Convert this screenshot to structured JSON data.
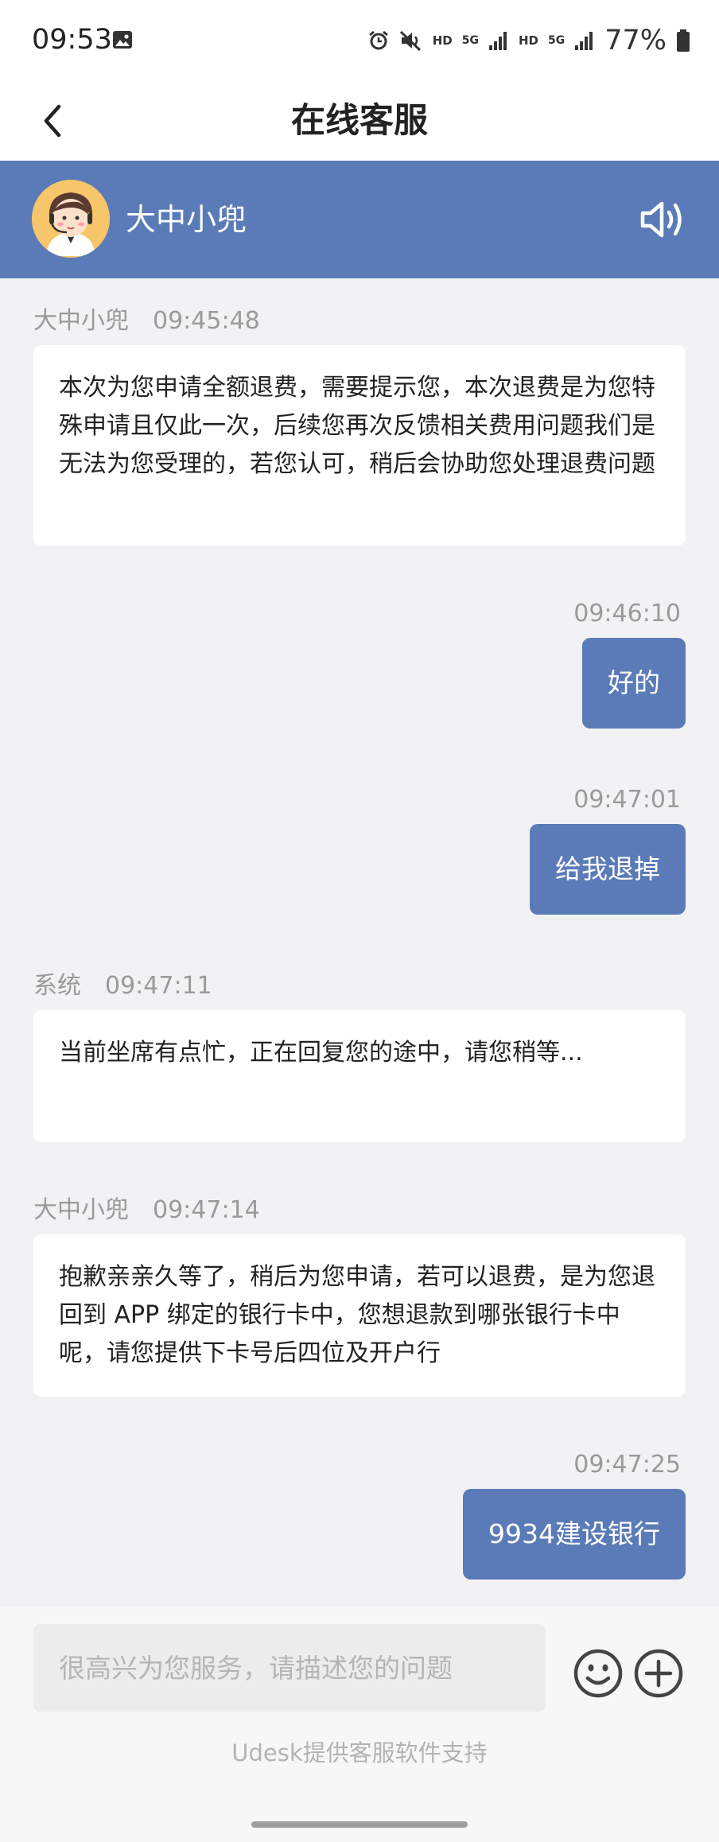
{
  "status_bar": {
    "time": "09:53",
    "hd1": "HD",
    "net1": "5G",
    "hd2": "HD",
    "net2": "5G",
    "battery": "77%"
  },
  "header": {
    "title": "在线客服"
  },
  "agent": {
    "name": "大中小兜"
  },
  "messages": [
    {
      "sender": "大中小兜",
      "time": "09:45:48",
      "text": "本次为您申请全额退费，需要提示您，本次退费是为您特殊申请且仅此一次，后续您再次反馈相关费用问题我们是无法为您受理的，若您认可，稍后会协助您处理退费问题"
    },
    {
      "time": "09:46:10",
      "text": "好的"
    },
    {
      "time": "09:47:01",
      "text": "给我退掉"
    },
    {
      "sender": "系统",
      "time": "09:47:11",
      "text": "当前坐席有点忙，正在回复您的途中，请您稍等..."
    },
    {
      "sender": "大中小兜",
      "time": "09:47:14",
      "text": "抱歉亲亲久等了，稍后为您申请，若可以退费，是为您退回到 APP 绑定的银行卡中，您想退款到哪张银行卡中呢，请您提供下卡号后四位及开户行"
    },
    {
      "time": "09:47:25",
      "text": "9934建设银行"
    }
  ],
  "input": {
    "placeholder": "很高兴为您服务，请描述您的问题"
  },
  "footer": {
    "note": "Udesk提供客服软件支持"
  },
  "colors": {
    "accent": "#5b7bb8",
    "background": "#f2f2f4",
    "bubble_in": "#ffffff"
  },
  "icons": [
    "gallery-icon",
    "alarm-icon",
    "mute-icon",
    "signal-icon",
    "battery-icon",
    "back-icon",
    "speaker-icon",
    "emoji-icon",
    "plus-icon"
  ]
}
